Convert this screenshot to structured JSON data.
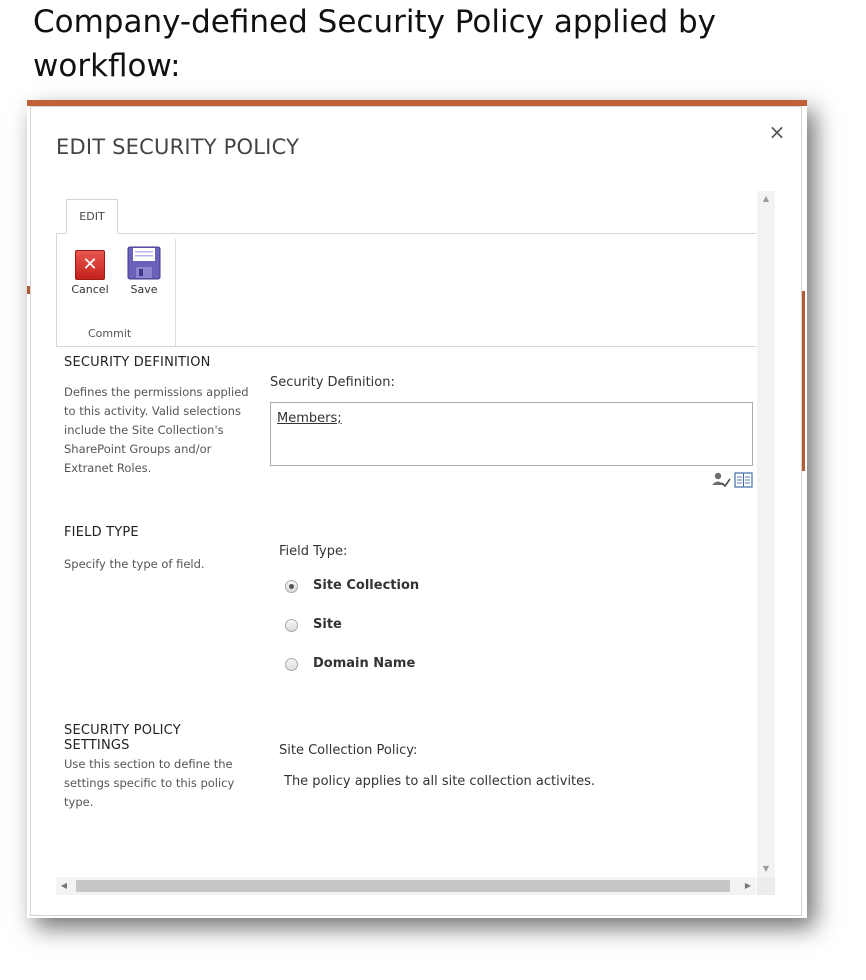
{
  "caption": "Company-defined Security Policy applied by workflow:",
  "dialog": {
    "title": "EDIT SECURITY POLICY",
    "close_glyph": "×"
  },
  "ribbon": {
    "tab_label": "EDIT",
    "cancel_label": "Cancel",
    "save_label": "Save",
    "group_label": "Commit"
  },
  "security_definition": {
    "heading": "SECURITY DEFINITION",
    "description": "Defines the permissions applied to this activity. Valid selections include the Site Collection's SharePoint Groups and/or Extranet Roles.",
    "field_label": "Security Definition:",
    "entries": [
      "Members;"
    ]
  },
  "field_type": {
    "heading": "FIELD TYPE",
    "description": "Specify the type of field.",
    "field_label": "Field Type:",
    "options": [
      {
        "label": "Site Collection",
        "selected": true
      },
      {
        "label": "Site",
        "selected": false
      },
      {
        "label": "Domain Name",
        "selected": false
      }
    ]
  },
  "policy_settings": {
    "heading": "SECURITY POLICY SETTINGS",
    "description": "Use this section to define the settings specific to this policy type.",
    "field_label": "Site Collection Policy:",
    "policy_text": "The policy applies to all site collection activites."
  },
  "icons": {
    "close": "close-icon",
    "cancel": "cancel-icon",
    "save": "save-icon",
    "check_names": "check-names-icon",
    "browse": "address-book-icon",
    "scroll_up": "scroll-up-arrow-icon",
    "scroll_down": "scroll-down-arrow-icon",
    "scroll_left": "scroll-left-arrow-icon",
    "scroll_right": "scroll-right-arrow-icon"
  },
  "colors": {
    "backdrop_accent": "#c0613a",
    "cancel_red": "#d9362e",
    "save_purple": "#6a62b8"
  }
}
